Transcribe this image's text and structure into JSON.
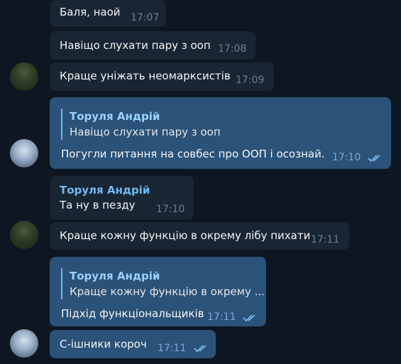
{
  "messages": [
    {
      "text": "Баля, наой",
      "time": "17:07"
    },
    {
      "text": "Навіщо слухати пару з ооп",
      "time": "17:08"
    },
    {
      "text": "Краще уніжать неомарксистів",
      "time": "17:09"
    },
    {
      "reply_name": "Торуля Андрій",
      "reply_text": "Навіщо слухати пару з ооп",
      "text": "Погугли питання на совбес про ООП і осознай.",
      "time": "17:10"
    },
    {
      "sender": "Торуля Андрій",
      "text": "Та ну в пезду",
      "time": "17:10"
    },
    {
      "text": "Краще кожну функцію в окрему лібу пихати",
      "time": "17:11"
    },
    {
      "reply_name": "Торуля Андрій",
      "reply_text": "Краще кожну функцію в окрему ...",
      "text": "Підхід функціональщиків",
      "time": "17:11"
    },
    {
      "text": "С-ішники короч",
      "time": "17:11"
    }
  ],
  "colors": {
    "background": "#0e1621",
    "incoming_bubble": "#182533",
    "outgoing_bubble": "#2b5278",
    "accent_name": "#71baf2"
  }
}
